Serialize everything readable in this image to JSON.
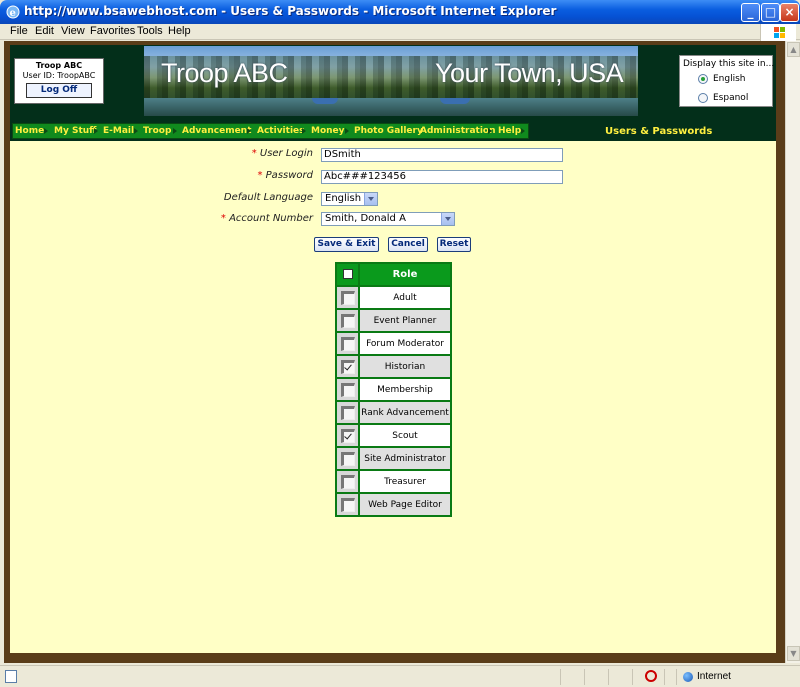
{
  "window": {
    "title": "http://www.bsawebhost.com - Users & Passwords - Microsoft Internet Explorer",
    "min": "_",
    "max": "□",
    "close": "×"
  },
  "menu": [
    "File",
    "Edit",
    "View",
    "Favorites",
    "Tools",
    "Help"
  ],
  "login_box": {
    "troop": "Troop ABC",
    "user_id_label": "User ID:",
    "user_id": "TroopABC",
    "logoff": "Log Off"
  },
  "banner": {
    "left_title": "Troop ABC",
    "right_title": "Your Town, USA"
  },
  "language_box": {
    "title": "Display this site in...",
    "options": [
      "English",
      "Espanol"
    ],
    "selected": "English"
  },
  "nav": [
    "Home",
    "My Stuff",
    "E-Mail",
    "Troop",
    "Advancement",
    "Activities",
    "Money",
    "Photo Gallery",
    "Administration",
    "Help"
  ],
  "page_title": "Users & Passwords",
  "form": {
    "required_mark": "*",
    "user_login_label": "User Login",
    "user_login_value": "DSmith",
    "password_label": "Password",
    "password_value": "Abc###123456",
    "default_language_label": "Default Language",
    "default_language_value": "English",
    "account_number_label": "Account Number",
    "account_number_value": "Smith, Donald A"
  },
  "buttons": {
    "save": "Save & Exit",
    "cancel": "Cancel",
    "reset": "Reset"
  },
  "roles": {
    "header": "Role",
    "items": [
      {
        "label": "Adult",
        "checked": false
      },
      {
        "label": "Event Planner",
        "checked": false
      },
      {
        "label": "Forum Moderator",
        "checked": false
      },
      {
        "label": "Historian",
        "checked": true
      },
      {
        "label": "Membership",
        "checked": false
      },
      {
        "label": "Rank Advancement",
        "checked": false
      },
      {
        "label": "Scout",
        "checked": true
      },
      {
        "label": "Site Administrator",
        "checked": false
      },
      {
        "label": "Treasurer",
        "checked": false
      },
      {
        "label": "Web Page Editor",
        "checked": false
      }
    ]
  },
  "status": {
    "zone": "Internet"
  }
}
